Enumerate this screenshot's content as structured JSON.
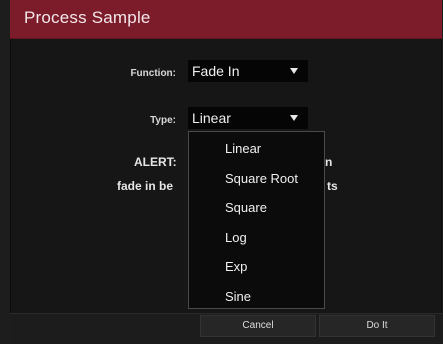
{
  "dialog": {
    "title": "Process Sample"
  },
  "function_field": {
    "label": "Function:",
    "value": "Fade In"
  },
  "type_field": {
    "label": "Type:",
    "value": "Linear",
    "options": [
      "Linear",
      "Square Root",
      "Square",
      "Log",
      "Exp",
      "Sine"
    ]
  },
  "alert": {
    "line1_left": "ALERT:",
    "line1_right": "n",
    "line2_left": "fade in be",
    "line2_right": "ts"
  },
  "buttons": {
    "cancel": "Cancel",
    "do_it": "Do It"
  },
  "colors": {
    "titlebar": "#7c1b2a",
    "background": "#161616",
    "select_bg": "#050505"
  }
}
